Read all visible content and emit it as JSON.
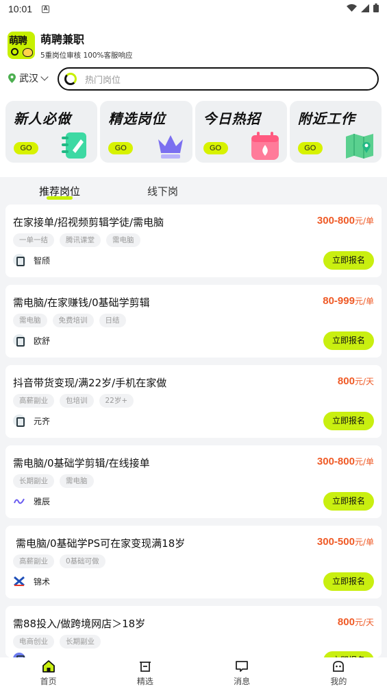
{
  "status_bar": {
    "time": "10:01",
    "notif_icon": "A"
  },
  "app": {
    "logo_text": "萌聘",
    "name": "萌聘兼职",
    "subtitle": "5重岗位审核 100%客服响应"
  },
  "location": {
    "city": "武汉"
  },
  "search": {
    "placeholder": "热门岗位"
  },
  "features": [
    {
      "title": "新人必做",
      "go": "GO",
      "icon": "notepad-icon"
    },
    {
      "title": "精选岗位",
      "go": "GO",
      "icon": "crown-icon"
    },
    {
      "title": "今日热招",
      "go": "GO",
      "icon": "calendar-icon"
    },
    {
      "title": "附近工作",
      "go": "GO",
      "icon": "map-icon"
    }
  ],
  "tabs": [
    {
      "label": "推荐岗位"
    },
    {
      "label": "线下岗"
    }
  ],
  "jobs": [
    {
      "title": "在家接单/招视频剪辑学徒/需电脑",
      "pay": "300-800",
      "unit": "元/单",
      "tags": [
        "一单一结",
        "腾讯课堂",
        "需电脑"
      ],
      "company": "智颀",
      "apply": "立即报名"
    },
    {
      "title": "需电脑/在家赚钱/0基础学剪辑",
      "pay": "80-999",
      "unit": "元/单",
      "tags": [
        "需电脑",
        "免费培训",
        "日结"
      ],
      "company": "欧舒",
      "apply": "立即报名"
    },
    {
      "title": "抖音带货变现/满22岁/手机在家做",
      "pay": "800",
      "unit": "元/天",
      "tags": [
        "高薪副业",
        "包培训",
        "22岁+"
      ],
      "company": "元齐",
      "apply": "立即报名"
    },
    {
      "title": "需电脑/0基础学剪辑/在线接单",
      "pay": "300-800",
      "unit": "元/单",
      "tags": [
        "长期副业",
        "需电脑"
      ],
      "company": "雅辰",
      "apply": "立即报名"
    },
    {
      "title": "需电脑/0基础学PS可在家变现满18岁",
      "pay": "300-500",
      "unit": "元/单",
      "tags": [
        "高薪副业",
        "0基础可做"
      ],
      "company": "锦术",
      "apply": "立即报名"
    },
    {
      "title": "需88投入/做跨境网店＞18岁",
      "pay": "800",
      "unit": "元/天",
      "tags": [
        "电商创业",
        "长期副业"
      ],
      "company": "",
      "apply": "立即报名"
    }
  ],
  "bottom_nav": [
    {
      "label": "首页",
      "icon": "home-icon"
    },
    {
      "label": "精选",
      "icon": "featured-icon"
    },
    {
      "label": "消息",
      "icon": "message-icon"
    },
    {
      "label": "我的",
      "icon": "profile-icon"
    }
  ],
  "colors": {
    "accent": "#c9ef10",
    "price": "#ef5a26"
  }
}
